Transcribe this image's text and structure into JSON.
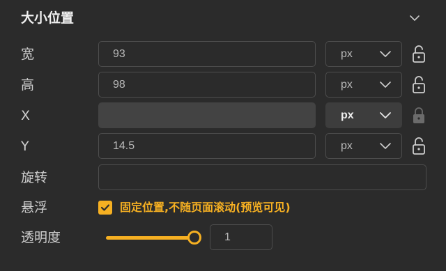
{
  "section": {
    "title": "大小位置",
    "collapse_icon": "chevron-down-icon"
  },
  "width": {
    "label": "宽",
    "value": "93",
    "unit": "px",
    "unit_icon": "chevron-down-icon",
    "lock_icon": "lock-open-icon"
  },
  "height": {
    "label": "高",
    "value": "98",
    "unit": "px",
    "unit_icon": "chevron-down-icon",
    "lock_icon": "lock-open-icon"
  },
  "x": {
    "label": "X",
    "value": "",
    "unit": "px",
    "unit_icon": "chevron-down-icon",
    "lock_icon": "lock-closed-icon",
    "disabled": true
  },
  "y": {
    "label": "Y",
    "value": "14.5",
    "unit": "px",
    "unit_icon": "chevron-down-icon",
    "lock_icon": "lock-open-icon"
  },
  "rotation": {
    "label": "旋转",
    "value": ""
  },
  "float": {
    "label": "悬浮",
    "checked": true,
    "checkbox_label": "固定位置,不随页面滚动(预览可见)"
  },
  "opacity": {
    "label": "透明度",
    "value": "1",
    "slider_level": 1.0
  },
  "colors": {
    "background": "#2b2b2b",
    "accent": "#f6b022",
    "border": "#4d4d4d",
    "disabled_field": "#434343",
    "text": "#d2d2d2"
  }
}
